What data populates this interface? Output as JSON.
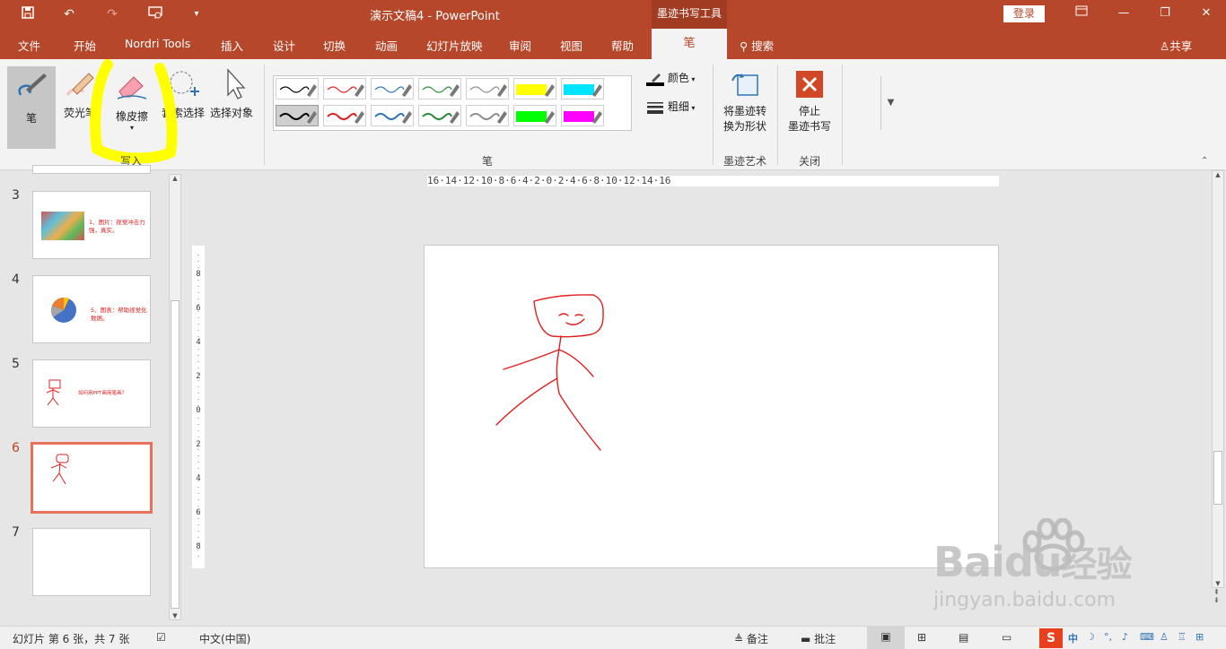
{
  "titlebar": {
    "title": "演示文稿4  -  PowerPoint",
    "contextual_group": "墨迹书写工具",
    "login": "登录"
  },
  "tabs": [
    "文件",
    "开始",
    "Nordri Tools",
    "插入",
    "设计",
    "切换",
    "动画",
    "幻灯片放映",
    "审阅",
    "视图",
    "帮助"
  ],
  "active_tab": "笔",
  "search": "搜索",
  "share": "共享",
  "ribbon": {
    "pen": "笔",
    "highlighter": "荧光笔",
    "eraser": "橡皮擦",
    "lasso": "套索选择",
    "select_objects": "选择对象",
    "group_write": "写入",
    "group_pens": "笔",
    "color": "颜色",
    "thickness": "粗细",
    "convert_line1": "将墨迹转",
    "convert_line2": "换为形状",
    "group_ink_art": "墨迹艺术",
    "stop_line1": "停止",
    "stop_line2": "墨迹书写",
    "group_close": "关闭"
  },
  "pen_colors_row1": [
    "#000000",
    "#e02020",
    "#2e74b5",
    "#2a8a3a",
    "#8c8c8c",
    "#ffff00",
    "#00e5ff"
  ],
  "pen_colors_row2": [
    "#000000",
    "#e02020",
    "#2e74b5",
    "#2a8a3a",
    "#8c8c8c",
    "#00ff00",
    "#ff00ff"
  ],
  "slides": [
    {
      "num": "3",
      "text": "1、图片：视觉冲击力强，真实。"
    },
    {
      "num": "4",
      "text": "5、图表：帮助视觉化数据。"
    },
    {
      "num": "5",
      "text": "如何用PPT画简笔画？"
    },
    {
      "num": "6",
      "text": ""
    },
    {
      "num": "7",
      "text": ""
    }
  ],
  "ruler_text": "16·14·12·10·8·6·4·2·0·2·4·6·8·10·12·14·16",
  "statusbar": {
    "slide_info": "幻灯片 第 6 张，共 7 张",
    "language": "中文(中国)",
    "notes": "备注",
    "comments": "批注"
  },
  "watermark": {
    "brand": "Baidu",
    "brand_cn": "经验",
    "url": "jingyan.baidu.com"
  },
  "annotation_color": "#ffff00"
}
